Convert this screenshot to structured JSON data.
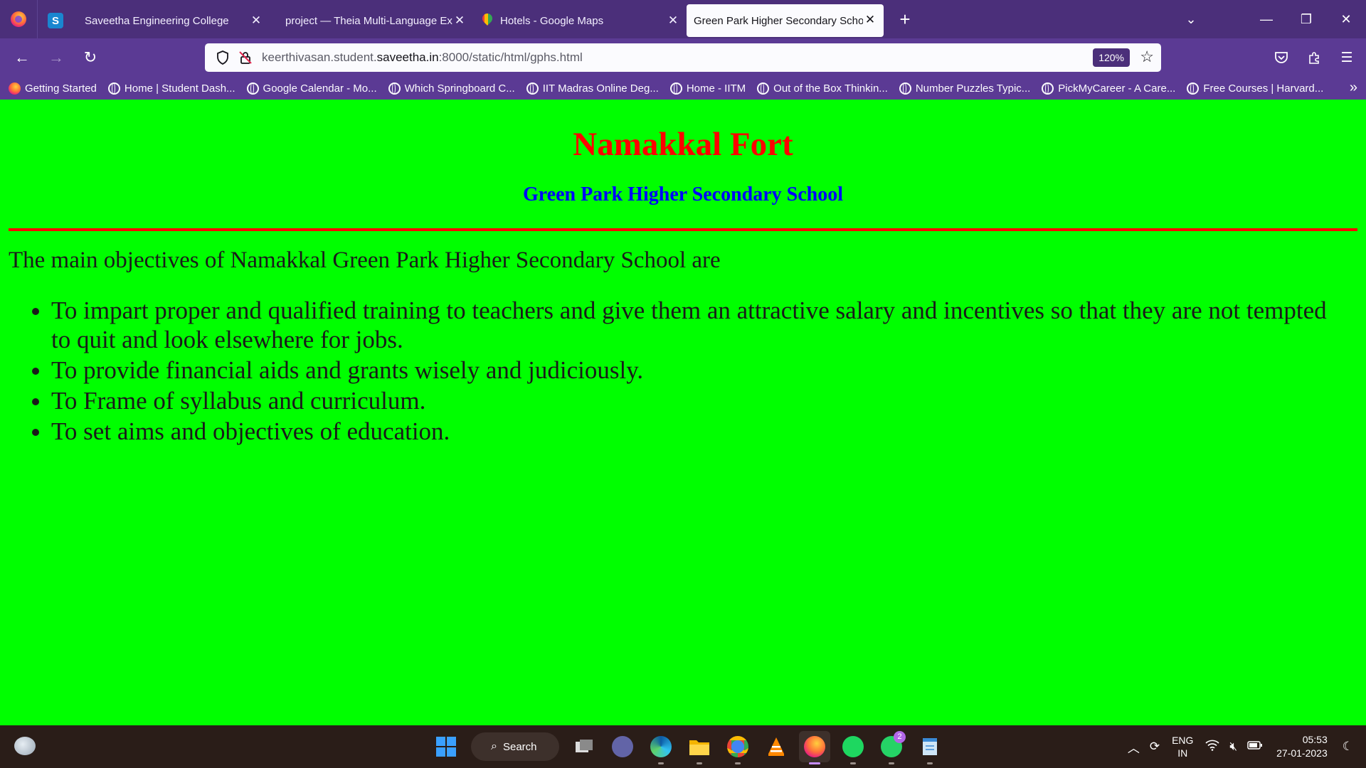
{
  "browser": {
    "tabs": [
      {
        "label": "Saveetha Engineering College",
        "icon": "saveetha-s-icon"
      },
      {
        "label": "project — Theia Multi-Language Ex",
        "icon": "theia-icon"
      },
      {
        "label": "Hotels - Google Maps",
        "icon": "google-maps-pin-icon"
      },
      {
        "label": "Green Park Higher Secondary Schoo",
        "icon": "none",
        "active": true
      }
    ],
    "url_prefix": "keerthivasan.student.",
    "url_domain": "saveetha.in",
    "url_suffix": ":8000/static/html/gphs.html",
    "zoom": "120%",
    "bookmarks": [
      "Getting Started",
      "Home | Student Dash...",
      "Google Calendar - Mo...",
      "Which Springboard C...",
      "IIT Madras Online Deg...",
      "Home - IITM",
      "Out of the Box Thinkin...",
      "Number Puzzles Typic...",
      "PickMyCareer - A Care...",
      "Free Courses | Harvard..."
    ]
  },
  "page": {
    "title": "Namakkal Fort",
    "subtitle": "Green Park Higher Secondary School",
    "intro": "The main objectives of Namakkal Green Park Higher Secondary School are",
    "objectives": [
      "To impart proper and qualified training to teachers and give them an attractive salary and incentives so that they are not tempted to quit and look elsewhere for jobs.",
      "To provide financial aids and grants wisely and judiciously.",
      "To Frame of syllabus and curriculum.",
      "To set aims and objectives of education."
    ],
    "colors": {
      "background": "#00ff00",
      "title": "#ff0000",
      "subtitle": "#0000ff",
      "rule": "#ff0000"
    }
  },
  "taskbar": {
    "search_label": "Search",
    "whatsapp_badge": "2",
    "lang_line1": "ENG",
    "lang_line2": "IN",
    "time": "05:53",
    "date": "27-01-2023"
  }
}
